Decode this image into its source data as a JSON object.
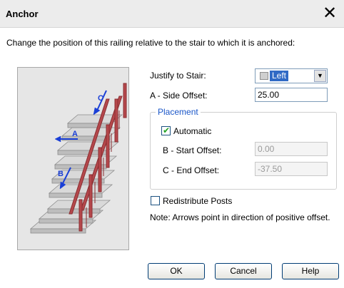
{
  "dialog": {
    "title": "Anchor",
    "close_glyph": "✕",
    "instruction": "Change the position of this railing relative to the stair to which it is anchored:"
  },
  "preview": {
    "arrow_labels": [
      "C",
      "A",
      "B"
    ],
    "colors": {
      "stair": "#d8d8d8",
      "railing": "#b5484c",
      "arrow": "#1a3fd6"
    }
  },
  "justify": {
    "label": "Justify to Stair:",
    "selected": "Left",
    "icon": "railing-swatch-icon"
  },
  "side_offset": {
    "label": "A - Side Offset:",
    "value": "25.00"
  },
  "placement": {
    "legend": "Placement",
    "automatic": {
      "label": "Automatic",
      "checked": true
    },
    "start_offset": {
      "label": "B - Start Offset:",
      "value": "0.00"
    },
    "end_offset": {
      "label": "C - End Offset:",
      "value": "-37.50"
    }
  },
  "redistribute": {
    "label": "Redistribute Posts",
    "checked": false
  },
  "note": "Note: Arrows point in direction of positive offset.",
  "buttons": {
    "ok": "OK",
    "cancel": "Cancel",
    "help": "Help"
  }
}
